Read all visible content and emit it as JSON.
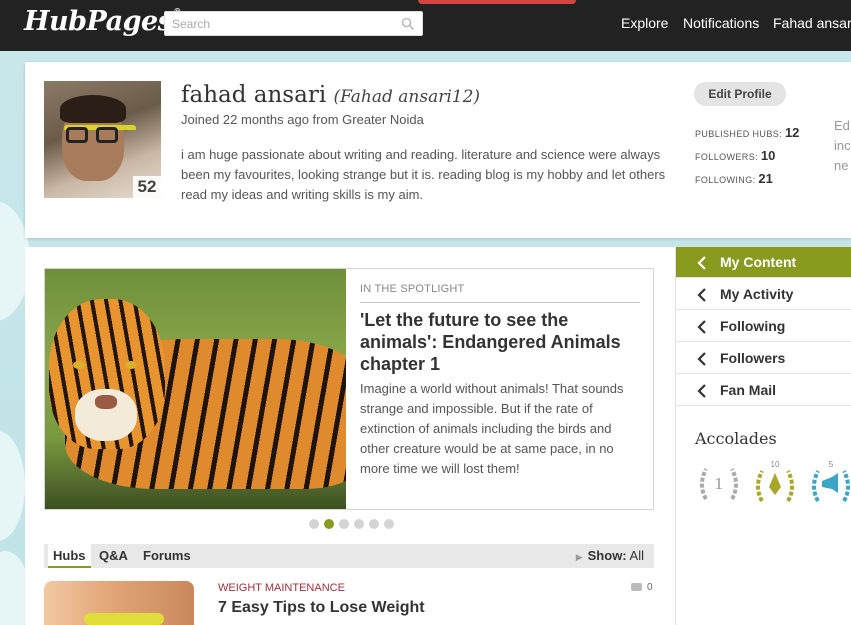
{
  "app": {
    "logo": "HubPages",
    "logo_mark": "®"
  },
  "search": {
    "placeholder": "Search",
    "value": ""
  },
  "nav": {
    "explore": "Explore",
    "notifications": "Notifications",
    "user": "Fahad ansari"
  },
  "profile": {
    "name": "fahad ansari",
    "username": "(Fahad ansari12)",
    "joined": "Joined 22 months ago from Greater Noida",
    "bio": "i am huge passionate about writing and reading. literature and science were always been my favourites, looking strange but it is. reading blog is my hobby and let others read my ideas and writing skills is my aim.",
    "score": "52",
    "edit_label": "Edit Profile",
    "stats": [
      {
        "label": "PUBLISHED HUBS:",
        "value": "12"
      },
      {
        "label": "FOLLOWERS:",
        "value": "10"
      },
      {
        "label": "FOLLOWING:",
        "value": "21"
      }
    ],
    "cutoff_lines": [
      "Ed",
      "inc",
      "ne"
    ]
  },
  "spotlight": {
    "label": "IN THE SPOTLIGHT",
    "title": "'Let the future to see the animals': Endangered Animals chapter 1",
    "text": "Imagine a world without animals! That sounds strange and impossible. But if the rate of extinction of animals including the birds and other creature would be at same pace, in no more time we will lost them!",
    "dots_count": 6,
    "active_dot": 2
  },
  "tabs": {
    "items": [
      "Hubs",
      "Q&A",
      "Forums"
    ],
    "active": 0,
    "show_label": "Show:",
    "show_value": "All"
  },
  "hub": {
    "category": "WEIGHT MAINTENANCE",
    "title": "7 Easy Tips to Lose Weight",
    "comments": "0"
  },
  "right_nav": {
    "items": [
      "My Content",
      "My Activity",
      "Following",
      "Followers",
      "Fan Mail"
    ],
    "active": 0
  },
  "accolades": {
    "title": "Accolades",
    "badges": [
      {
        "number": "1",
        "icon": "silver-laurel-icon",
        "color": "#a9a9a9"
      },
      {
        "number": "10",
        "icon": "gold-quill-laurel-icon",
        "color": "#a9a62a"
      },
      {
        "number": "5",
        "icon": "megaphone-laurel-icon",
        "color": "#3ba4c9"
      }
    ]
  },
  "colors": {
    "accent": "#8a9a1f",
    "topbar": "#222222",
    "category": "#a0313a"
  }
}
